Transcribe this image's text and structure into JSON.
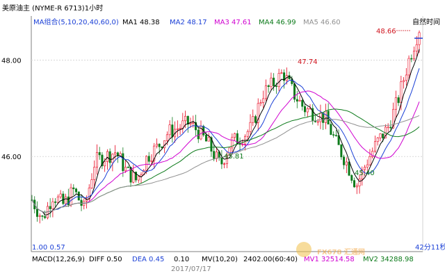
{
  "window_title": "美原油主 (NYME-R 6713)1小时",
  "top_right_label": "自然时间",
  "ma_bar": {
    "group": "MA组合(5,10,20,40,60,0)",
    "items": [
      {
        "label": "MA1 48.38",
        "color": "#000000"
      },
      {
        "label": "MA2 48.17",
        "color": "#1a3fd6"
      },
      {
        "label": "MA3 47.61",
        "color": "#d000d0"
      },
      {
        "label": "MA4 46.99",
        "color": "#0c7a1a"
      },
      {
        "label": "MA5 46.60",
        "color": "#909090"
      }
    ]
  },
  "y_ticks": [
    "48.00",
    "46.00"
  ],
  "annotations": {
    "last_price": "48.66",
    "peak": "47.74",
    "low_left": "45.81",
    "low_right": "45.40"
  },
  "bottom_left_text": "1.00 0.57",
  "clock": "42分11秒",
  "macd_bar": {
    "macd": "MACD(12,26,9)",
    "diff": "DIFF 0.50",
    "dea": "DEA 0.45",
    "macd_value": "0.10",
    "mv": "MV(10,20)",
    "vol": "2402.00(60:40)",
    "mv1": "MV1 32514.58",
    "mv2": "MV2 34288.98"
  },
  "date_label": "2017/07/17",
  "watermark": "FX678 汇通网",
  "colors": {
    "up": "#e8001a",
    "down": "#0c7a1a",
    "bar": "#e8001a",
    "ma1": "#000000",
    "ma2": "#1a3fd6",
    "ma3": "#d000d0",
    "ma4": "#0c7a1a",
    "ma5": "#909090",
    "annotation_green": "#0c7a1a",
    "annotation_red": "#d0141e"
  },
  "chart_data": {
    "type": "line",
    "title": "美原油主 (NYME-R 6713)1小时",
    "ylim": [
      44.2,
      48.7
    ],
    "y_ticks": [
      46.0,
      48.0
    ],
    "price_path": [
      {
        "t": 0,
        "v": 45.1
      },
      {
        "t": 4,
        "v": 44.7
      },
      {
        "t": 8,
        "v": 45.2
      },
      {
        "t": 12,
        "v": 45.0
      },
      {
        "t": 16,
        "v": 45.3
      },
      {
        "t": 20,
        "v": 44.9
      },
      {
        "t": 24,
        "v": 45.9
      },
      {
        "t": 28,
        "v": 46.0
      },
      {
        "t": 32,
        "v": 46.1
      },
      {
        "t": 36,
        "v": 45.7
      },
      {
        "t": 40,
        "v": 45.5
      },
      {
        "t": 44,
        "v": 46.0
      },
      {
        "t": 48,
        "v": 46.2
      },
      {
        "t": 52,
        "v": 46.5
      },
      {
        "t": 56,
        "v": 46.6
      },
      {
        "t": 60,
        "v": 46.7
      },
      {
        "t": 64,
        "v": 46.5
      },
      {
        "t": 68,
        "v": 46.2
      },
      {
        "t": 72,
        "v": 45.81
      },
      {
        "t": 76,
        "v": 46.3
      },
      {
        "t": 80,
        "v": 46.4
      },
      {
        "t": 84,
        "v": 46.6
      },
      {
        "t": 88,
        "v": 47.3
      },
      {
        "t": 92,
        "v": 47.5
      },
      {
        "t": 96,
        "v": 47.74
      },
      {
        "t": 100,
        "v": 47.3
      },
      {
        "t": 104,
        "v": 47.0
      },
      {
        "t": 108,
        "v": 46.9
      },
      {
        "t": 112,
        "v": 46.8
      },
      {
        "t": 116,
        "v": 46.3
      },
      {
        "t": 120,
        "v": 45.9
      },
      {
        "t": 124,
        "v": 45.4
      },
      {
        "t": 128,
        "v": 45.9
      },
      {
        "t": 132,
        "v": 46.3
      },
      {
        "t": 136,
        "v": 46.6
      },
      {
        "t": 140,
        "v": 47.2
      },
      {
        "t": 144,
        "v": 48.0
      },
      {
        "t": 148,
        "v": 48.66
      }
    ],
    "series": [
      {
        "name": "MA1",
        "value": 48.38
      },
      {
        "name": "MA2",
        "value": 48.17
      },
      {
        "name": "MA3",
        "value": 47.61
      },
      {
        "name": "MA4",
        "value": 46.99
      },
      {
        "name": "MA5",
        "value": 46.6
      }
    ]
  }
}
